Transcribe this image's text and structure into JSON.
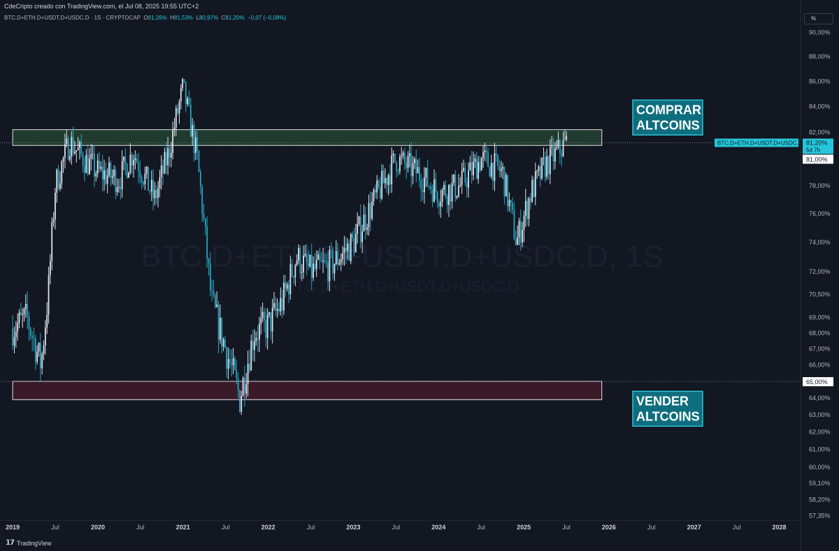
{
  "header": {
    "attribution": "CdeCripto creado con TradingView.com, el Jul 08, 2025 19:55 UTC+2",
    "symbol": "BTC.D+ETH.D+USDT.D+USDC.D · 1S · CRYPTOCAP",
    "ohlc": {
      "o_label": "O",
      "o": "81,26%",
      "h_label": "H",
      "h": "81,53%",
      "l_label": "L",
      "l": "80,97%",
      "c_label": "C",
      "c": "81,20%",
      "change": "−0,07 (−0,08%)"
    },
    "scale_mode": "%"
  },
  "footer": {
    "logo": "TradingView"
  },
  "chart_data": {
    "type": "candlestick",
    "log_scale": true,
    "watermark": {
      "line1": "BTC.D+ETH.D+USDT.D+USDC.D, 1S",
      "line2": "BTC.D+ETH.D+USDT.D+USDC.D"
    },
    "y_ticks": [
      "90,00%",
      "88,00%",
      "86,00%",
      "84,00%",
      "82,00%",
      "80,00%",
      "78,00%",
      "76,00%",
      "74,00%",
      "72,00%",
      "70,50%",
      "69,00%",
      "68,00%",
      "67,00%",
      "66,00%",
      "65,00%",
      "64,00%",
      "63,00%",
      "62,00%",
      "61,00%",
      "60,00%",
      "59,10%",
      "58,20%",
      "57,35%"
    ],
    "y_tick_values": [
      90,
      88,
      86,
      84,
      82,
      80,
      78,
      76,
      74,
      72,
      70.5,
      69,
      68,
      67,
      66,
      65,
      64,
      63,
      62,
      61,
      60,
      59.1,
      58.2,
      57.35
    ],
    "x_labels": [
      "2019",
      "Jul",
      "2020",
      "Jul",
      "2021",
      "Jul",
      "2022",
      "Jul",
      "2023",
      "Jul",
      "2024",
      "Jul",
      "2025",
      "Jul",
      "2026",
      "Jul",
      "2027",
      "Jul",
      "2028"
    ],
    "x_label_dates": [
      "2019-01",
      "2019-07",
      "2020-01",
      "2020-07",
      "2021-01",
      "2021-07",
      "2022-01",
      "2022-07",
      "2023-01",
      "2023-07",
      "2024-01",
      "2024-07",
      "2025-01",
      "2025-07",
      "2026-01",
      "2026-07",
      "2027-01",
      "2027-07",
      "2028-01"
    ],
    "x_range": [
      "2018-12",
      "2028-04"
    ],
    "price_path": [
      {
        "d": "2019-01",
        "v": 68.3
      },
      {
        "d": "2019-03",
        "v": 69.0
      },
      {
        "d": "2019-05",
        "v": 66.0
      },
      {
        "d": "2019-06",
        "v": 70.5
      },
      {
        "d": "2019-07",
        "v": 78.0
      },
      {
        "d": "2019-09",
        "v": 81.3
      },
      {
        "d": "2019-11",
        "v": 80.0
      },
      {
        "d": "2020-01",
        "v": 79.0
      },
      {
        "d": "2020-04",
        "v": 78.5
      },
      {
        "d": "2020-06",
        "v": 80.5
      },
      {
        "d": "2020-09",
        "v": 77.0
      },
      {
        "d": "2020-11",
        "v": 80.5
      },
      {
        "d": "2021-01",
        "v": 85.5
      },
      {
        "d": "2021-03",
        "v": 80.0
      },
      {
        "d": "2021-05",
        "v": 70.0
      },
      {
        "d": "2021-07",
        "v": 67.0
      },
      {
        "d": "2021-09",
        "v": 64.0
      },
      {
        "d": "2021-11",
        "v": 68.0
      },
      {
        "d": "2022-01",
        "v": 68.5
      },
      {
        "d": "2022-03",
        "v": 70.0
      },
      {
        "d": "2022-05",
        "v": 73.0
      },
      {
        "d": "2022-07",
        "v": 72.0
      },
      {
        "d": "2022-10",
        "v": 72.5
      },
      {
        "d": "2023-01",
        "v": 74.0
      },
      {
        "d": "2023-04",
        "v": 77.0
      },
      {
        "d": "2023-07",
        "v": 80.0
      },
      {
        "d": "2023-10",
        "v": 79.0
      },
      {
        "d": "2024-01",
        "v": 77.5
      },
      {
        "d": "2024-04",
        "v": 78.0
      },
      {
        "d": "2024-07",
        "v": 80.0
      },
      {
        "d": "2024-10",
        "v": 79.0
      },
      {
        "d": "2024-12",
        "v": 74.0
      },
      {
        "d": "2025-02",
        "v": 77.5
      },
      {
        "d": "2025-04",
        "v": 79.5
      },
      {
        "d": "2025-07",
        "v": 81.2
      }
    ],
    "zones": [
      {
        "name": "buy-zone",
        "label_lines": [
          "COMPRAR",
          "ALTCOINS"
        ],
        "from": "2019-01",
        "to": "2025-12",
        "low": 81.0,
        "high": 82.2,
        "fill": "#1f3a2e",
        "border": "#e6e6e6",
        "label_bg": "#0e6e7e",
        "label_border": "#2cc4d8"
      },
      {
        "name": "sell-zone",
        "label_lines": [
          "VENDER",
          "ALTCOINS"
        ],
        "from": "2019-01",
        "to": "2025-12",
        "low": 63.9,
        "high": 65.0,
        "fill": "#3a1a28",
        "border": "#e6e6e6",
        "label_bg": "#0e6e7e",
        "label_border": "#2cc4d8"
      }
    ],
    "reference_lines": [
      {
        "name": "current-price-line",
        "value": 81.2
      },
      {
        "name": "support-line",
        "value": 65.0
      }
    ],
    "price_tags": [
      {
        "name": "current-price-tag",
        "symbol": "BTC.D+ETH.D+USDT.D+USDC.D",
        "value_text": "81,20%",
        "countdown": "5d 7h",
        "value": 81.2,
        "bg": "#26c6da",
        "fg": "#0b1a20"
      },
      {
        "name": "level-81-tag",
        "value_text": "81,00%",
        "value": 81.0,
        "bg": "#ffffff",
        "fg": "#131722"
      },
      {
        "name": "level-65-tag",
        "value_text": "65,00%",
        "value": 65.0,
        "bg": "#ffffff",
        "fg": "#131722"
      }
    ],
    "colors": {
      "up": "#e0e3eb",
      "down": "#26a6c2",
      "background": "#131722",
      "axis_text": "#b2b5be"
    }
  }
}
